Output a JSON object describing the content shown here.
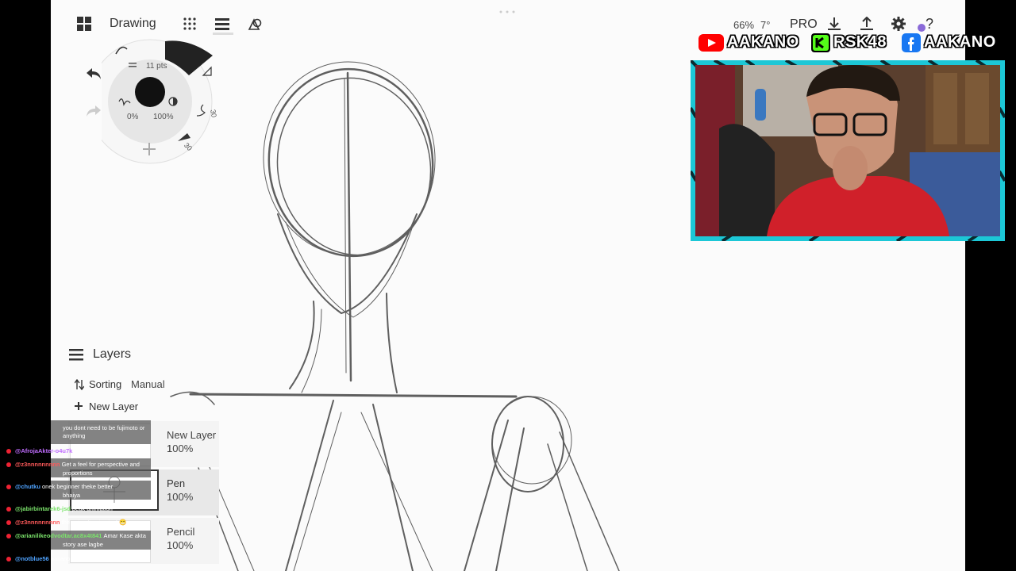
{
  "app": {
    "title": "Drawing"
  },
  "status": {
    "zoom": "66%",
    "rotation": "7°",
    "pro_label": "PRO"
  },
  "brush_wheel": {
    "size": "11 pts",
    "opacity_min": "0%",
    "opacity_max": "100%",
    "smoothing_a": "30",
    "smoothing_b": "30"
  },
  "layers": {
    "title": "Layers",
    "sorting_label": "Sorting",
    "sorting_value": "Manual",
    "new_layer_label": "New Layer",
    "items": [
      {
        "name": "New Layer 1",
        "opacity": "100%"
      },
      {
        "name": "Pen",
        "opacity": "100%"
      },
      {
        "name": "Pencil",
        "opacity": "100%"
      }
    ]
  },
  "social": {
    "youtube": "AAKANO",
    "kick": "RSK48",
    "facebook": "AAKANO"
  },
  "colors": {
    "youtube": "#ff0000",
    "kick": "#53fc18",
    "facebook": "#1877f2",
    "webcam_frame": "#1cc7d6"
  },
  "chat": [
    {
      "user": "",
      "text": "you dont need to be fujimoto or"
    },
    {
      "user": "",
      "text": "anything"
    },
    {
      "user": "@AfrojaAkter-o4u7k",
      "text": "মাশাআল্লাহ সুন্দর"
    },
    {
      "user": "@z3nnnnnnnnn",
      "text": "Get a feel for perspective and"
    },
    {
      "user": "",
      "text": "proportions"
    },
    {
      "user": "@chutku",
      "text": "onek beginner theke better"
    },
    {
      "user": "",
      "text": "bhaiya"
    },
    {
      "user": "@jabirbintarek6-jsd",
      "text": "peak animation"
    },
    {
      "user": "@z3nnnnnnnnn",
      "text": "the animation is nice! 😁"
    },
    {
      "user": "@arianilikeodvodtar.ac8x4t841",
      "text": "Amar Kase akta"
    },
    {
      "user": "",
      "text": "story ase lagbe"
    },
    {
      "user": "@notblue56",
      "text": "aakano the next mangaka"
    }
  ]
}
